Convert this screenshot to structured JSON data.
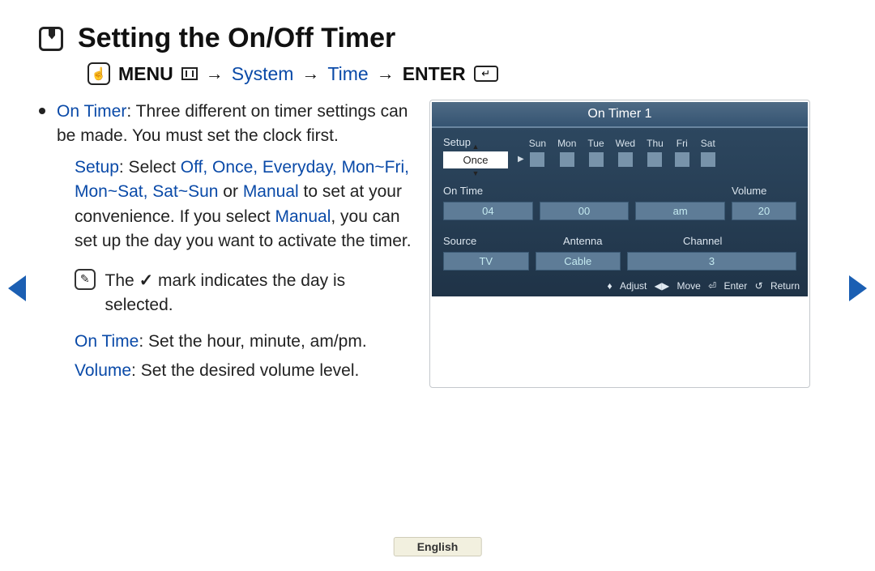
{
  "title": "Setting the On/Off Timer",
  "nav": {
    "menu": "MENU",
    "system": "System",
    "time": "Time",
    "enter": "ENTER"
  },
  "body": {
    "onTimerLabel": "On Timer",
    "onTimerDesc": ": Three different on timer settings can be made. You must set the clock first.",
    "setupLabel": "Setup",
    "setupDesc1": ": Select ",
    "setupOptions": "Off, Once, Everyday, Mon~Fri, Mon~Sat, Sat~Sun",
    "setupOr": " or ",
    "setupManual": "Manual",
    "setupDesc2": " to set at your convenience. If you select ",
    "setupManual2": "Manual",
    "setupDesc3": ", you can set up the day you want to activate the timer.",
    "noteThe": "The ",
    "noteMark": "c",
    "noteRest": " mark indicates the day is selected.",
    "onTimeLabel": "On Time",
    "onTimeDesc": ": Set the hour, minute, am/pm.",
    "volumeLabel": "Volume",
    "volumeDesc": ": Set the desired volume level."
  },
  "panel": {
    "title": "On Timer 1",
    "setupLabel": "Setup",
    "setupValue": "Once",
    "days": [
      "Sun",
      "Mon",
      "Tue",
      "Wed",
      "Thu",
      "Fri",
      "Sat"
    ],
    "onTimeLabel": "On Time",
    "volumeLabel": "Volume",
    "hour": "04",
    "minute": "00",
    "ampm": "am",
    "volume": "20",
    "sourceLabel": "Source",
    "antennaLabel": "Antenna",
    "channelLabel": "Channel",
    "source": "TV",
    "antenna": "Cable",
    "channel": "3",
    "footer": {
      "adjust": "Adjust",
      "move": "Move",
      "enter": "Enter",
      "ret": "Return"
    }
  },
  "language": "English"
}
